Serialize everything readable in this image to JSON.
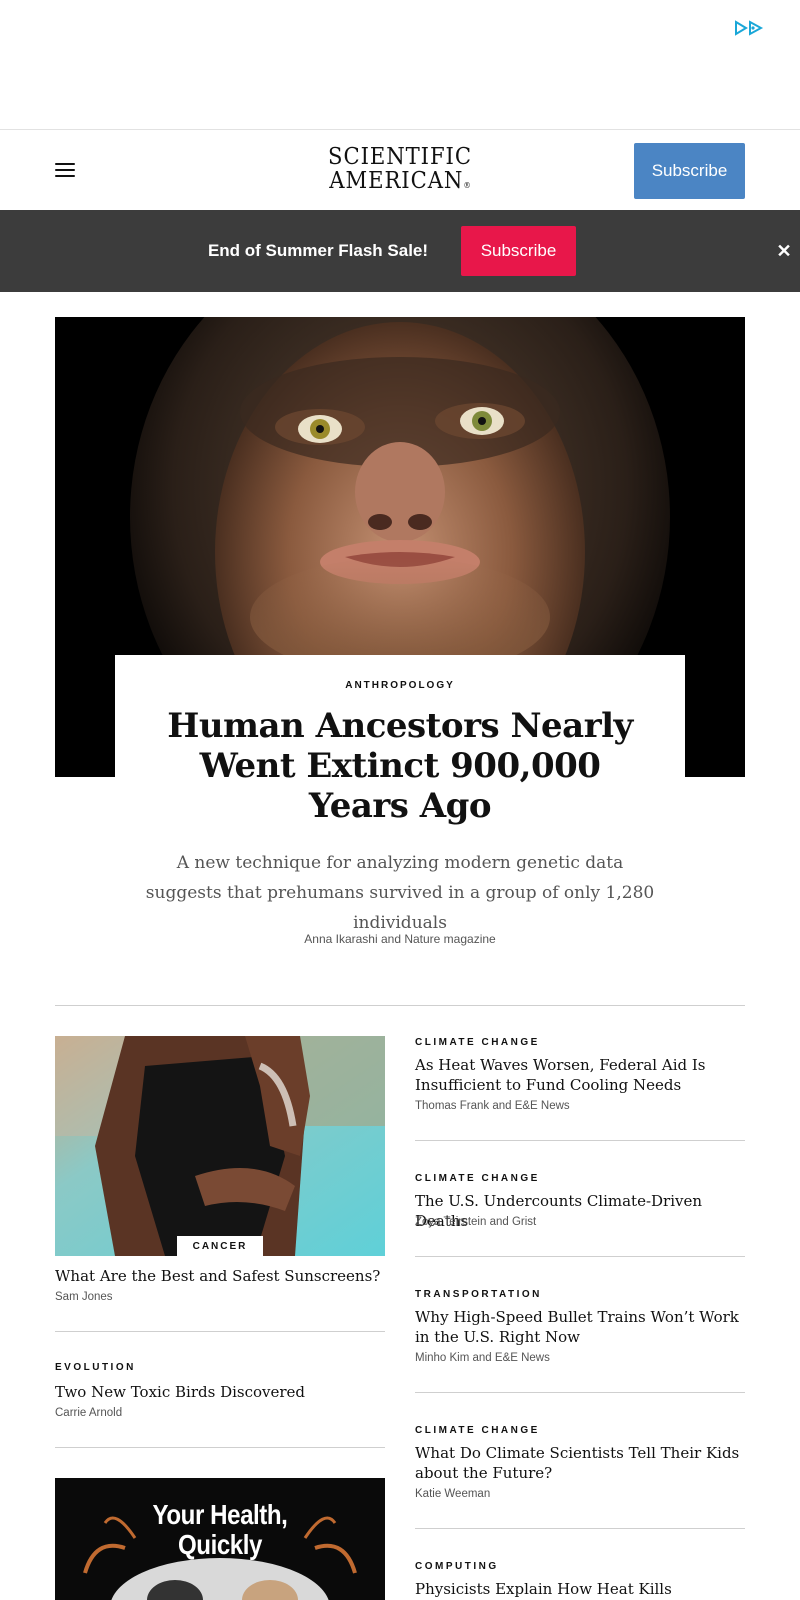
{
  "ad": {
    "choices_icon": "adchoices-icon"
  },
  "header": {
    "menu_icon": "hamburger-menu-icon",
    "logo_line1": "SCIENTIFIC",
    "logo_line2": "AMERICAN",
    "logo_mark": "®",
    "subscribe_label": "Subscribe",
    "subscribe_color": "#4b85c4"
  },
  "promo": {
    "text": "End of Summer Flash Sale!",
    "subscribe_label": "Subscribe",
    "subscribe_color": "#e8174a",
    "close_label": "✕"
  },
  "hero": {
    "kicker": "ANTHROPOLOGY",
    "title": "Human Ancestors Nearly Went Extinct 900,000 Years Ago",
    "dek": "A new technique for analyzing modern genetic data suggests that prehumans survived in a group of only 1,280 individuals",
    "byline": "Anna Ikarashi and Nature magazine"
  },
  "left_column": [
    {
      "kicker": "CANCER",
      "title": "What Are the Best and Safest Sunscreens?",
      "byline": "Sam Jones"
    },
    {
      "kicker": "EVOLUTION",
      "title": "Two New Toxic Birds Discovered",
      "byline": "Carrie Arnold"
    },
    {
      "image_title_line1": "Your Health,",
      "image_title_line2": "Quickly"
    }
  ],
  "right_column": [
    {
      "kicker": "CLIMATE CHANGE",
      "title": "As Heat Waves Worsen, Federal Aid Is Insufficient to Fund Cooling Needs",
      "byline": "Thomas Frank and E&E News"
    },
    {
      "kicker": "CLIMATE CHANGE",
      "title": "The U.S. Undercounts Climate-Driven Deaths",
      "byline": "Zoya Teirstein and Grist"
    },
    {
      "kicker": "TRANSPORTATION",
      "title": "Why High-Speed Bullet Trains Won’t Work in the U.S. Right Now",
      "byline": "Minho Kim and E&E News"
    },
    {
      "kicker": "CLIMATE CHANGE",
      "title": "What Do Climate Scientists Tell Their Kids about the Future?",
      "byline": "Katie Weeman"
    },
    {
      "kicker": "COMPUTING",
      "title": "Physicists Explain How Heat Kills Machines"
    }
  ]
}
